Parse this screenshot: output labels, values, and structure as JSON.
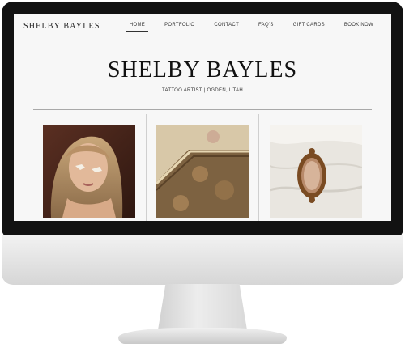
{
  "site": {
    "logo": "SHELBY BAYLES",
    "nav": [
      {
        "label": "HOME",
        "active": true
      },
      {
        "label": "PORTFOLIO",
        "active": false
      },
      {
        "label": "CONTACT",
        "active": false
      },
      {
        "label": "FAQ'S",
        "active": false
      },
      {
        "label": "GIFT CARDS",
        "active": false
      },
      {
        "label": "BOOK NOW",
        "active": false
      }
    ],
    "hero": {
      "title": "SHELBY BAYLES",
      "subtitle": "TATTOO ARTIST | OGDEN, UTAH"
    }
  },
  "gallery": [
    {
      "image": "portrait-with-face-tattoo-photo"
    },
    {
      "image": "ornate-ceiling-photo"
    },
    {
      "image": "ornate-mirror-on-bedsheets-photo"
    }
  ],
  "device": {
    "bezel_color": "#121212",
    "chin_color": "#e3e3e3",
    "screen_background": "#f7f7f7"
  }
}
